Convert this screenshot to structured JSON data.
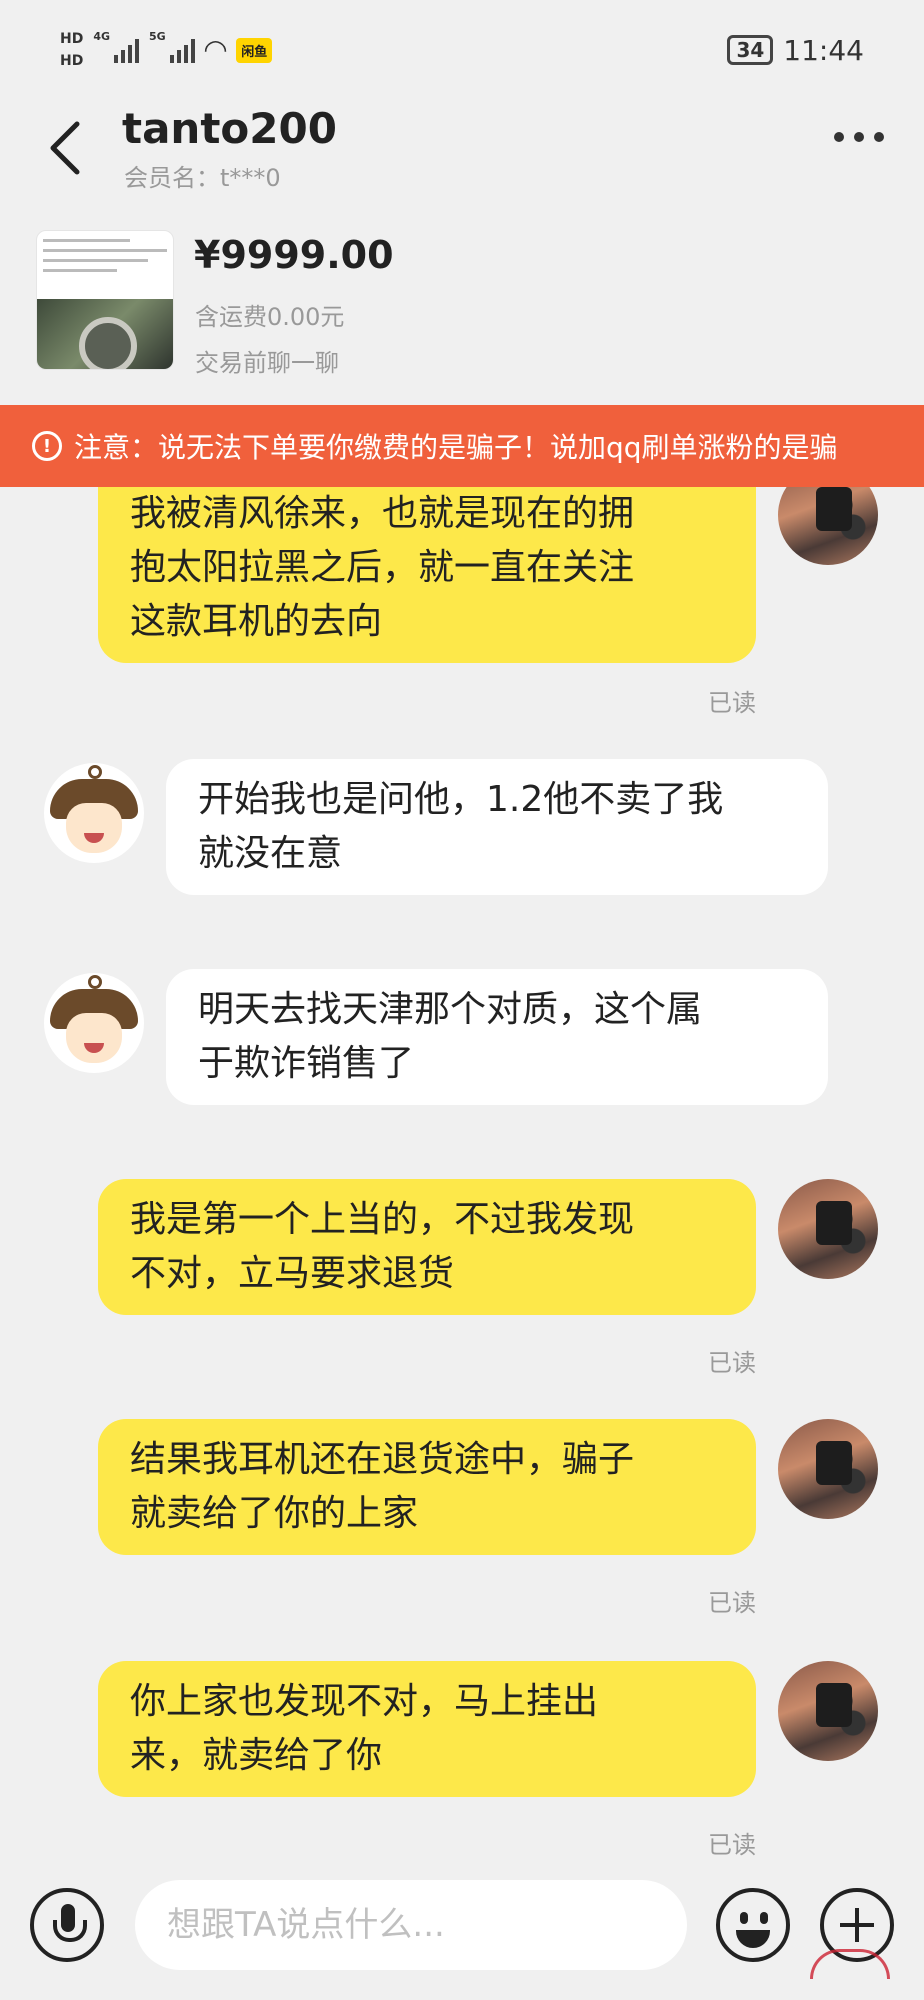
{
  "status_bar": {
    "hd1": "HD",
    "hd2": "HD",
    "net1": "4G",
    "net2": "5G",
    "app_badge": "闲鱼",
    "battery": "34",
    "time": "11:44"
  },
  "header": {
    "title": "tanto200",
    "subtitle": "会员名：t***0"
  },
  "product": {
    "price": "¥9999.00",
    "shipping": "含运费0.00元",
    "chat_first": "交易前聊一聊"
  },
  "warning": {
    "text": "注意：说无法下单要你缴费的是骗子！说加qq刷单涨粉的是骗"
  },
  "messages": [
    {
      "side": "me",
      "text_lines": [
        "我被清风徐来，也就是现在的拥",
        "抱太阳拉黑之后，就一直在关注",
        "这款耳机的去向"
      ],
      "read": "已读"
    },
    {
      "side": "them",
      "text_lines": [
        "开始我也是问他，1.2他不卖了我",
        "就没在意"
      ]
    },
    {
      "side": "them",
      "text_lines": [
        "明天去找天津那个对质，这个属",
        "于欺诈销售了"
      ]
    },
    {
      "side": "me",
      "text_lines": [
        "我是第一个上当的，不过我发现",
        "不对，立马要求退货"
      ],
      "read": "已读"
    },
    {
      "side": "me",
      "text_lines": [
        "结果我耳机还在退货途中，骗子",
        "就卖给了你的上家"
      ],
      "read": "已读"
    },
    {
      "side": "me",
      "text_lines": [
        "你上家也发现不对，马上挂出",
        "来，就卖给了你"
      ],
      "read": "已读"
    }
  ],
  "input_bar": {
    "placeholder": "想跟TA说点什么..."
  },
  "colors": {
    "me_bubble": "#fde84a",
    "them_bubble": "#ffffff",
    "warning_bg": "#f0603c",
    "background": "#f0f0f0"
  },
  "icons": [
    "back-arrow-icon",
    "more-icon",
    "warning-icon",
    "mic-icon",
    "emoji-icon",
    "plus-icon",
    "wifi-icon",
    "signal-icon",
    "battery-icon"
  ]
}
